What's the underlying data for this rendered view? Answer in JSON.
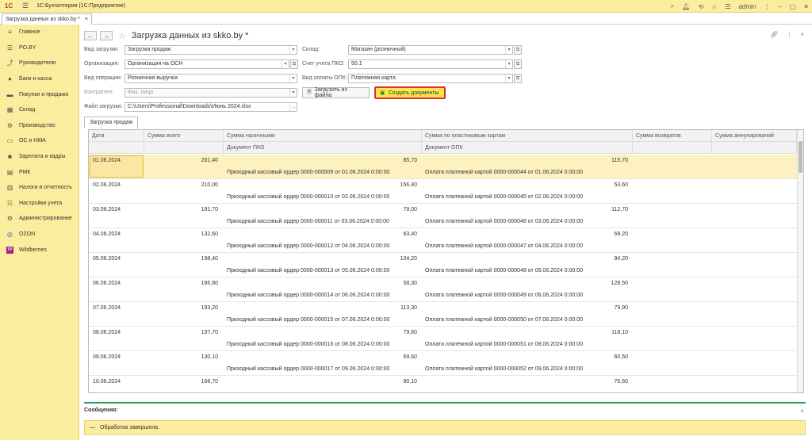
{
  "app": {
    "logo": "1С",
    "title": "1С:Бухгалтерия  (1С:Предприятие)",
    "user": "admin"
  },
  "tab": {
    "label": "Загрузка данных из skko.by *"
  },
  "sidebar": {
    "items": [
      {
        "label": "Главное",
        "icon": "menu-icon"
      },
      {
        "label": "PO.BY",
        "icon": "list-icon"
      },
      {
        "label": "Руководителю",
        "icon": "chart-icon"
      },
      {
        "label": "Банк и касса",
        "icon": "bank-icon"
      },
      {
        "label": "Покупки и продажи",
        "icon": "cart-icon"
      },
      {
        "label": "Склад",
        "icon": "warehouse-icon"
      },
      {
        "label": "Производство",
        "icon": "factory-icon"
      },
      {
        "label": "ОС и НМА",
        "icon": "car-icon"
      },
      {
        "label": "Зарплата и кадры",
        "icon": "people-icon"
      },
      {
        "label": "РМК",
        "icon": "register-icon"
      },
      {
        "label": "Налоги и отчетность",
        "icon": "tax-icon"
      },
      {
        "label": "Настройки учета",
        "icon": "settings-list-icon"
      },
      {
        "label": "Администрирование",
        "icon": "gear-icon"
      },
      {
        "label": "OZON",
        "icon": "ozon-icon"
      },
      {
        "label": "Wildberries",
        "icon": "wb-icon"
      }
    ]
  },
  "form": {
    "title": "Загрузка данных из skko.by *",
    "load_type_label": "Вид загрузки:",
    "load_type": "Загрузка продаж",
    "warehouse_label": "Склад:",
    "warehouse": "Магазин (розничный)",
    "org_label": "Организация:",
    "org": "Организация на ОСН",
    "pko_account_label": "Счет учета ПКО:",
    "pko_account": "50.1",
    "operation_label": "Вид операции:",
    "operation": "Розничная выручка",
    "opk_type_label": "Вид оплаты ОПК:",
    "opk_type": "Платежная карта",
    "counterparty_label": "Контрагент:",
    "counterparty": "Физ. лицо",
    "file_label": "Файл загрузки:",
    "file": "C:\\Users\\Professional\\Downloads\\Июнь 2024.xlsx",
    "load_button": "Загрузить из файла",
    "create_button": "Создать документы",
    "sales_tab": "Загрузка продаж"
  },
  "table": {
    "columns": [
      "Дата",
      "Сумма всего",
      "Сумма наличными",
      "Сумма по пластиковым картам",
      "Сумма возвратов",
      "Сумма аннулирований"
    ],
    "subcolumns": [
      "Документ ПКО",
      "Документ ОПК"
    ],
    "rows": [
      {
        "date": "01.06.2024",
        "total": "201,40",
        "cash": "85,70",
        "card": "115,70",
        "pko": "Приходный кассовый ордер 0000-000009 от 01.06.2024 0:00:00",
        "opk": "Оплата платежной картой 0000-000044 от 01.06.2024 0:00:00"
      },
      {
        "date": "02.06.2024",
        "total": "210,00",
        "cash": "156,40",
        "card": "53,60",
        "pko": "Приходный кассовый ордер 0000-000010 от 02.06.2024 0:00:00",
        "opk": "Оплата платежной картой 0000-000045 от 02.06.2024 0:00:00"
      },
      {
        "date": "03.06.2024",
        "total": "191,70",
        "cash": "79,00",
        "card": "112,70",
        "pko": "Приходный кассовый ордер 0000-000011 от 03.06.2024 0:00:00",
        "opk": "Оплата платежной картой 0000-000046 от 03.06.2024 0:00:00"
      },
      {
        "date": "04.06.2024",
        "total": "132,60",
        "cash": "63,40",
        "card": "69,20",
        "pko": "Приходный кассовый ордер 0000-000012 от 04.06.2024 0:00:00",
        "opk": "Оплата платежной картой 0000-000047 от 04.06.2024 0:00:00"
      },
      {
        "date": "05.06.2024",
        "total": "198,40",
        "cash": "104,20",
        "card": "94,20",
        "pko": "Приходный кассовый ордер 0000-000013 от 05.06.2024 0:00:00",
        "opk": "Оплата платежной картой 0000-000048 от 05.06.2024 0:00:00"
      },
      {
        "date": "06.06.2024",
        "total": "186,80",
        "cash": "58,30",
        "card": "128,50",
        "pko": "Приходный кассовый ордер 0000-000014 от 06.06.2024 0:00:00",
        "opk": "Оплата платежной картой 0000-000049 от 06.06.2024 0:00:00"
      },
      {
        "date": "07.06.2024",
        "total": "193,20",
        "cash": "113,30",
        "card": "79,90",
        "pko": "Приходный кассовый ордер 0000-000015 от 07.06.2024 0:00:00",
        "opk": "Оплата платежной картой 0000-000050 от 07.06.2024 0:00:00"
      },
      {
        "date": "08.06.2024",
        "total": "197,70",
        "cash": "79,60",
        "card": "118,10",
        "pko": "Приходный кассовый ордер 0000-000016 от 08.06.2024 0:00:00",
        "opk": "Оплата платежной картой 0000-000051 от 08.06.2024 0:00:00"
      },
      {
        "date": "09.06.2024",
        "total": "130,10",
        "cash": "69,60",
        "card": "60,50",
        "pko": "Приходный кассовый ордер 0000-000017 от 09.06.2024 0:00:00",
        "opk": "Оплата платежной картой 0000-000052 от 09.06.2024 0:00:00"
      },
      {
        "date": "10.06.2024",
        "total": "166,70",
        "cash": "90,10",
        "card": "76,60",
        "pko": "",
        "opk": ""
      }
    ]
  },
  "messages": {
    "title": "Сообщения:",
    "text": "Обработка завершена."
  }
}
